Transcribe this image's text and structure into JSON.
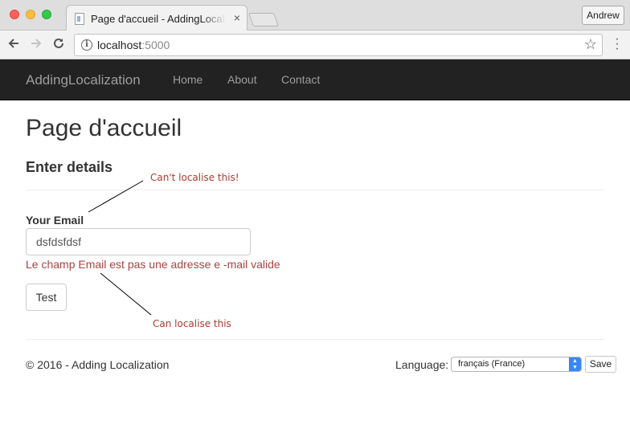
{
  "browser": {
    "tab_title": "Page d'accueil - AddingLocalization",
    "tab_close": "×",
    "profile_name": "Andrew",
    "url_host": "localhost",
    "url_port": ":5000",
    "icons": {
      "back": "arrow-left-icon",
      "forward": "arrow-right-icon",
      "reload": "reload-icon",
      "info": "info-icon",
      "bookmark": "star-icon",
      "menu": "vertical-dots-icon"
    }
  },
  "navbar": {
    "brand": "AddingLocalization",
    "links": [
      "Home",
      "About",
      "Contact"
    ]
  },
  "main": {
    "page_title": "Page d'accueil",
    "section_title": "Enter details",
    "email_label": "Your Email",
    "email_value": "dsfdsfdsf",
    "validation_message": "Le champ Email est pas une adresse e -mail valide",
    "submit_label": "Test"
  },
  "annotations": {
    "cant_localise": "Can't localise this!",
    "can_localise": "Can localise this"
  },
  "footer": {
    "copyright": "© 2016 - Adding Localization",
    "language_label": "Language:",
    "language_selected": "français (France)",
    "save_label": "Save"
  },
  "colors": {
    "navbar_bg": "#222222",
    "navbar_text": "#9d9d9d",
    "error_text": "#a94442",
    "annotation_text": "#b03a2e",
    "select_accent": "#3a86f7"
  }
}
